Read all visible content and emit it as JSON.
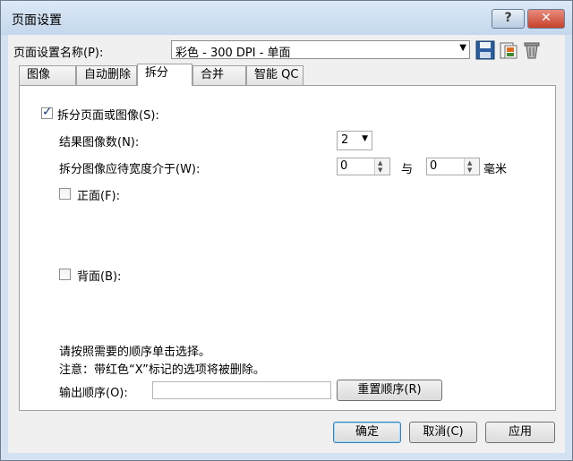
{
  "window": {
    "title": "页面设置"
  },
  "header": {
    "setting_name_label": "页面设置名称(P):",
    "setting_name_value": "彩色 - 300 DPI - 单面"
  },
  "tabs": [
    {
      "label": "图像"
    },
    {
      "label": "自动删除"
    },
    {
      "label": "拆分"
    },
    {
      "label": "合并"
    },
    {
      "label": "智能 QC"
    }
  ],
  "split": {
    "split_checkbox_label": "拆分页面或图像(S):",
    "result_count_label": "结果图像数(N):",
    "result_count_value": "2",
    "width_label": "拆分图像应待宽度介于(W):",
    "width_from": "0",
    "and_label": "与",
    "width_to": "0",
    "unit_label": "毫米",
    "front_label": "正面(F):",
    "back_label": "背面(B):",
    "instruction": "请按照需要的顺序单击选择。",
    "note": "注意：带红色“X”标记的选项将被删除。",
    "output_order_label": "输出顺序(O):",
    "output_order_value": "",
    "reset_order_button": "重置顺序(R)"
  },
  "footer": {
    "ok": "确定",
    "cancel": "取消(C)",
    "apply": "应用"
  }
}
